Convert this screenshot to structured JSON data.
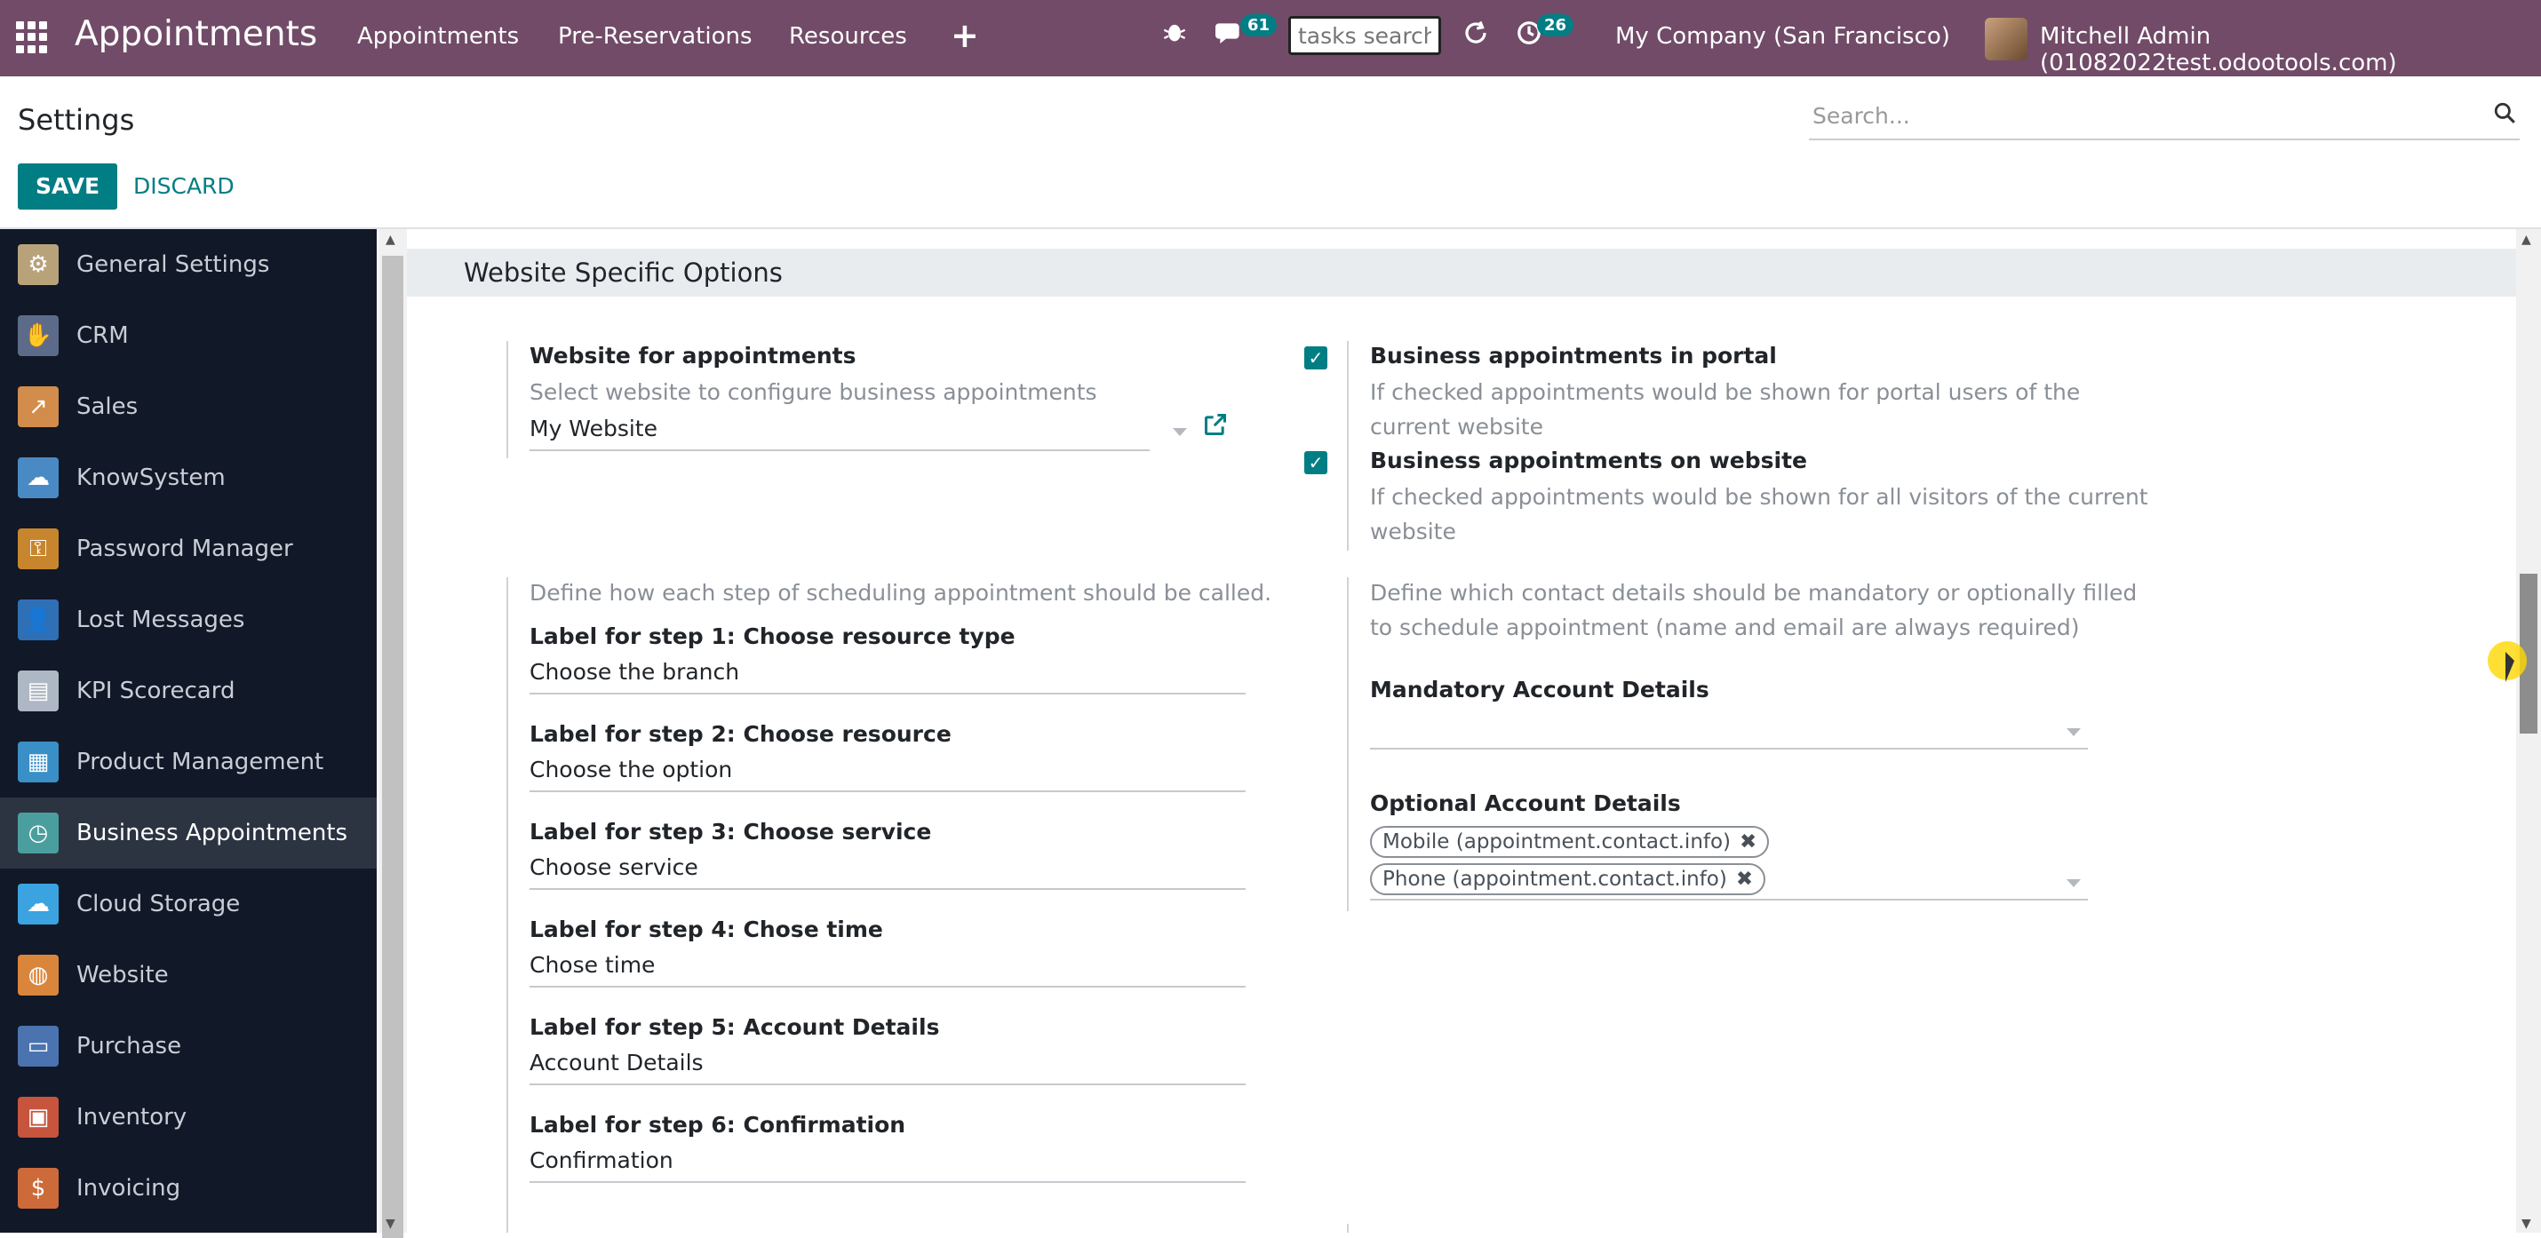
{
  "topbar": {
    "app_title": "Appointments",
    "menu": [
      "Appointments",
      "Pre-Reservations",
      "Resources"
    ],
    "plus_icon": "plus-icon",
    "messages_badge": "61",
    "activity_badge": "26",
    "tasks_search_placeholder": "tasks search",
    "company": "My Company (San Francisco)",
    "user": "Mitchell Admin (01082022test.odootools.com)"
  },
  "control": {
    "title": "Settings",
    "search_placeholder": "Search...",
    "save_label": "SAVE",
    "discard_label": "DISCARD"
  },
  "sidebar": {
    "items": [
      {
        "label": "General Settings",
        "icon": "gear-icon",
        "color": "#b8a27a"
      },
      {
        "label": "CRM",
        "icon": "handshake-icon",
        "color": "#5d6b8a"
      },
      {
        "label": "Sales",
        "icon": "chart-icon",
        "color": "#d28c4b"
      },
      {
        "label": "KnowSystem",
        "icon": "brain-icon",
        "color": "#4a8ac4"
      },
      {
        "label": "Password Manager",
        "icon": "key-icon",
        "color": "#c7862e"
      },
      {
        "label": "Lost Messages",
        "icon": "person-icon",
        "color": "#2f6fb5"
      },
      {
        "label": "KPI Scorecard",
        "icon": "scorecard-icon",
        "color": "#aeb8c4"
      },
      {
        "label": "Product Management",
        "icon": "product-icon",
        "color": "#3a8fc7"
      },
      {
        "label": "Business Appointments",
        "icon": "clock-icon",
        "color": "#4b9e9e"
      },
      {
        "label": "Cloud Storage",
        "icon": "cloud-icon",
        "color": "#3aa3e0"
      },
      {
        "label": "Website",
        "icon": "globe-icon",
        "color": "#d9863c"
      },
      {
        "label": "Purchase",
        "icon": "card-icon",
        "color": "#4a73b0"
      },
      {
        "label": "Inventory",
        "icon": "box-icon",
        "color": "#c7543d"
      },
      {
        "label": "Invoicing",
        "icon": "invoice-icon",
        "color": "#cc6a3a"
      }
    ]
  },
  "section": {
    "title": "Website Specific Options",
    "website_label": "Website for appointments",
    "website_hint": "Select website to configure business appointments",
    "website_value": "My Website",
    "portal_label": "Business appointments in portal",
    "portal_hint_1": "If checked appointments would be shown for portal users of the",
    "portal_hint_2": "current website",
    "website_opt_label": "Business appointments on website",
    "website_opt_hint_1": "If checked appointments would be shown for all visitors of the current",
    "website_opt_hint_2": "website",
    "steps_hint": "Define how each step of scheduling appointment should be called.",
    "steps": [
      {
        "label": "Label for step 1: Choose resource type",
        "value": "Choose the branch"
      },
      {
        "label": "Label for step 2: Choose resource",
        "value": "Choose the option"
      },
      {
        "label": "Label for step 3: Choose service",
        "value": "Choose service"
      },
      {
        "label": "Label for step 4: Chose time",
        "value": "Chose time"
      },
      {
        "label": "Label for step 5: Account Details",
        "value": "Account Details"
      },
      {
        "label": "Label for step 6: Confirmation",
        "value": "Confirmation"
      }
    ],
    "contact_hint_1": "Define which contact details should be mandatory or optionally filled",
    "contact_hint_2": "to schedule appointment (name and email are always required)",
    "mandatory_label": "Mandatory Account Details",
    "optional_label": "Optional Account Details",
    "optional_tags": [
      "Mobile (appointment.contact.info)",
      "Phone (appointment.contact.info)"
    ]
  }
}
